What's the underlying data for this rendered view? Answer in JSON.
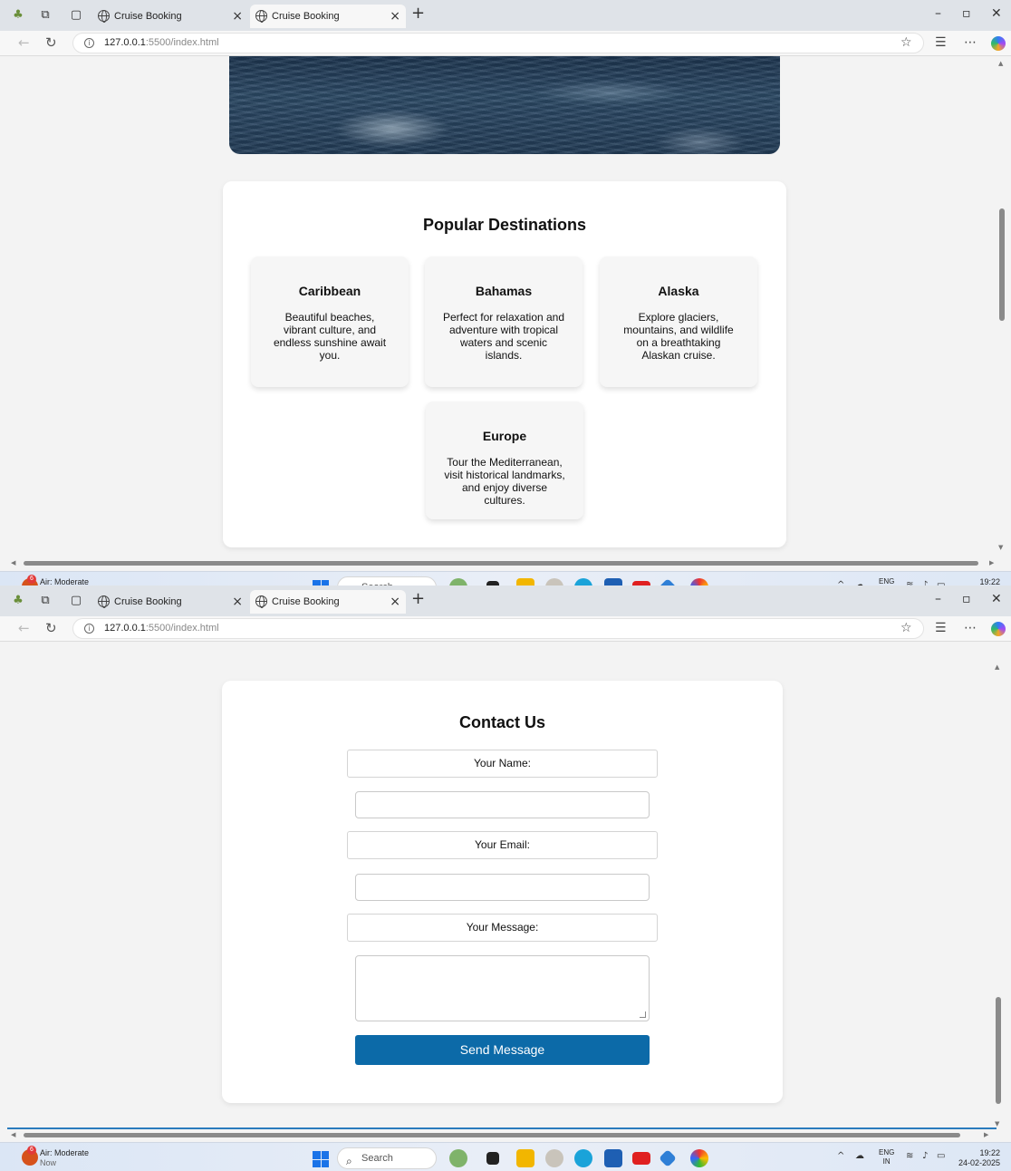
{
  "browser": {
    "tabs": [
      {
        "title": "Cruise Booking"
      },
      {
        "title": "Cruise Booking"
      }
    ],
    "url_host": "127.0.0.1",
    "url_rest": ":5500/index.html"
  },
  "destinations": {
    "title": "Popular Destinations",
    "items": [
      {
        "name": "Caribbean",
        "desc": "Beautiful beaches, vibrant culture, and endless sunshine await you."
      },
      {
        "name": "Bahamas",
        "desc": "Perfect for relaxation and adventure with tropical waters and scenic islands."
      },
      {
        "name": "Alaska",
        "desc": "Explore glaciers, mountains, and wildlife on a breathtaking Alaskan cruise."
      },
      {
        "name": "Europe",
        "desc": "Tour the Mediterranean, visit historical landmarks, and enjoy diverse cultures."
      }
    ]
  },
  "contact": {
    "title": "Contact Us",
    "name_label": "Your Name:",
    "email_label": "Your Email:",
    "message_label": "Your Message:",
    "submit_label": "Send Message"
  },
  "taskbar": {
    "weather_title": "Air: Moderate",
    "weather_sub": "Now",
    "weather_badge": "6",
    "search_placeholder": "Search",
    "lang_top": "ENG",
    "lang_bottom": "IN",
    "time": "19:22",
    "date": "24-02-2025"
  },
  "colors": {
    "accent": "#0c6aa8",
    "page_bg": "#f3f3f3",
    "card_bg": "#ffffff",
    "dest_card_bg": "#f6f6f6"
  },
  "icons": [
    "globe-icon",
    "close-icon",
    "plus-icon",
    "back-icon",
    "refresh-icon",
    "info-icon",
    "star-icon",
    "favorites-icon",
    "more-icon",
    "copilot-icon",
    "windows-start-icon",
    "search-icon",
    "wifi-icon",
    "volume-icon",
    "battery-icon"
  ]
}
